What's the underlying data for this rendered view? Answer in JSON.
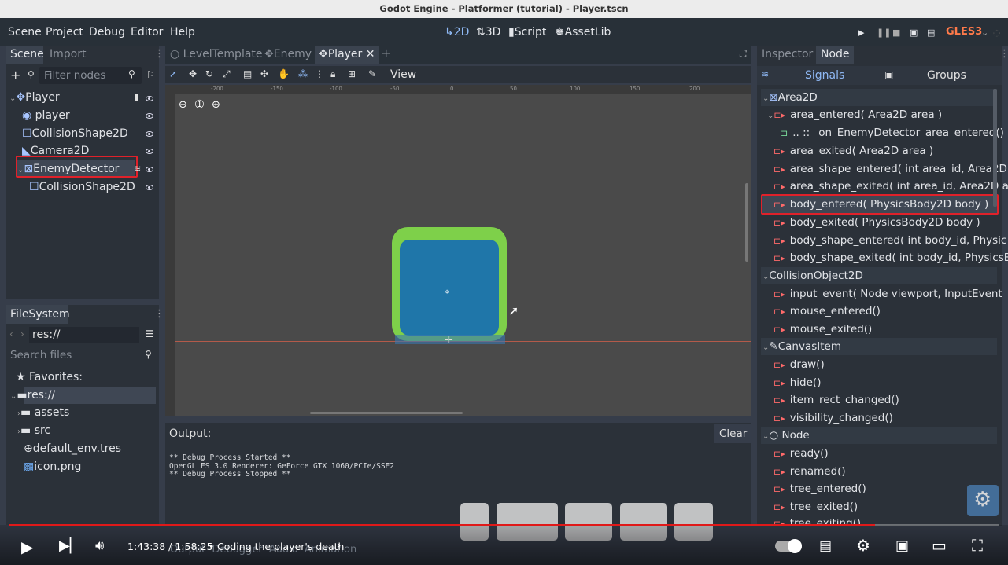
{
  "window": {
    "title": "Godot Engine - Platformer (tutorial) - Player.tscn"
  },
  "menu": [
    "Scene",
    "Project",
    "Debug",
    "Editor",
    "Help"
  ],
  "workspaces": {
    "w2d": "2D",
    "w3d": "3D",
    "script": "Script",
    "assetlib": "AssetLib"
  },
  "renderer": "GLES3",
  "scene_dock": {
    "tabs": [
      "Scene",
      "Import"
    ],
    "filter_placeholder": "Filter nodes",
    "nodes": [
      "Player",
      "player",
      "CollisionShape2D",
      "Camera2D",
      "EnemyDetector",
      "CollisionShape2D"
    ]
  },
  "filesystem": {
    "title": "FileSystem",
    "path": "res://",
    "search_placeholder": "Search files",
    "items": [
      "Favorites:",
      "res://",
      "assets",
      "src",
      "default_env.tres",
      "icon.png"
    ]
  },
  "scene_tabs": [
    "LevelTemplate",
    "Enemy",
    "Player"
  ],
  "toolbar": {
    "view": "View"
  },
  "ruler": [
    "-200",
    "-150",
    "-100",
    "-50",
    "0",
    "50",
    "100",
    "150",
    "200"
  ],
  "output": {
    "title": "Output:",
    "clear": "Clear",
    "lines": [
      "** Debug Process Started **",
      "OpenGL ES 3.0 Renderer: GeForce GTX 1060/PCIe/SSE2",
      "** Debug Process Stopped **"
    ]
  },
  "bottom_tabs": [
    "Output",
    "Debugger",
    "Audio",
    "Animation"
  ],
  "inspector": {
    "tabs": [
      "Inspector",
      "Node"
    ],
    "subtabs": {
      "signals": "Signals",
      "groups": "Groups"
    },
    "sections": [
      "Area2D",
      "CollisionObject2D",
      "CanvasItem",
      "Node"
    ],
    "area2d": [
      "area_entered( Area2D area )",
      ".. :: _on_EnemyDetector_area_entered()",
      "area_exited( Area2D area )",
      "area_shape_entered( int area_id, Area2D",
      "area_shape_exited( int area_id, Area2D ar",
      "body_entered( PhysicsBody2D body )",
      "body_exited( PhysicsBody2D body )",
      "body_shape_entered( int body_id, Physic",
      "body_shape_exited( int body_id, PhysicsB"
    ],
    "collision": [
      "input_event( Node viewport, InputEvent",
      "mouse_entered()",
      "mouse_exited()"
    ],
    "canvas": [
      "draw()",
      "hide()",
      "item_rect_changed()",
      "visibility_changed()"
    ],
    "node": [
      "ready()",
      "renamed()",
      "tree_entered()",
      "tree_exited()",
      "tree_exiting()"
    ]
  },
  "video": {
    "time": "1:43:38 / 1:58:25",
    "chapter": "Coding the player's death",
    "progress": 0.875
  },
  "colors": {
    "accent": "#8fb9f5",
    "highlight": "#e0212a",
    "signal": "#ff6a6a",
    "sprite_green": "#7ed04a",
    "sprite_blue": "#1f76a9"
  }
}
